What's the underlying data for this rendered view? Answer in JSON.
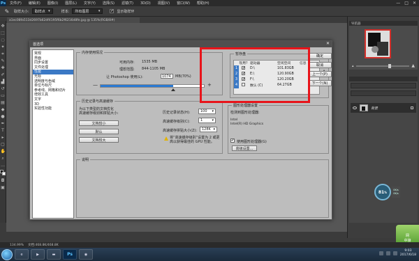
{
  "app": {
    "logo": "Ps",
    "menu": [
      "文件(F)",
      "编辑(E)",
      "图像(I)",
      "图层(L)",
      "文字(Y)",
      "选择(S)",
      "滤镜(T)",
      "3D(D)",
      "视图(V)",
      "窗口(W)",
      "帮助(H)"
    ],
    "window_controls": [
      "—",
      "□",
      "✕"
    ]
  },
  "options_bar": {
    "size_label": "取样大小:",
    "size_value": "取样点",
    "sample_label": "样本:",
    "sample_value": "所有图层",
    "ring_label": "显示取样环"
  },
  "document_tab": "a1ec08fa513d2697b62df4195f6b2f6216d8fe.jpg @ 135%(RGB/8#)",
  "dialog": {
    "title": "首选项",
    "close": "✕",
    "categories": [
      "常规",
      "界面",
      "同步设置",
      "文件处理",
      "性能",
      "光标",
      "透明度与色域",
      "单位与标尺",
      "参考线、网格和切片",
      "增效工具",
      "文字",
      "3D",
      "实验性功能"
    ],
    "selected_category": 4,
    "memory": {
      "legend": "内存使用情况",
      "available_label": "可用内存:",
      "available_value": "1535 MB",
      "ideal_label": "理想范围:",
      "ideal_value": "844-1105 MB",
      "use_label": "让 Photoshop 使用(L):",
      "use_value": "1074",
      "use_suffix": "MB(70%)",
      "percent": 70,
      "minus": "—",
      "plus": "+"
    },
    "scratch": {
      "legend": "暂存盘",
      "headers": [
        "现用?",
        "驱动器",
        "空闲空间",
        "信息"
      ],
      "rows": [
        {
          "index": "1",
          "active": "✔",
          "drive": "D:\\",
          "space": "101.83GB",
          "info": ""
        },
        {
          "index": "2",
          "active": "✔",
          "drive": "E:\\",
          "space": "120.90GB",
          "info": ""
        },
        {
          "index": "3",
          "active": "✔",
          "drive": "F:\\",
          "space": "120.20GB",
          "info": ""
        },
        {
          "index": "4",
          "active": "",
          "drive": "数认 (C)",
          "space": "64.27GB",
          "info": ""
        }
      ],
      "up_arrow": "▲",
      "down_arrow": "▼"
    },
    "buttons": {
      "ok": "确定",
      "cancel": "取消",
      "prev": "上一个(P)",
      "next": "下一个(N)"
    },
    "history": {
      "legend": "历史记录与高速缓存",
      "desc1": "为以下类型的文档优化",
      "desc2": "高速缓存级别和拼贴大小:",
      "btn_small": "文档较小",
      "btn_default": "默认",
      "btn_large": "文档较大",
      "states_label": "历史记录状态(H):",
      "states_value": "100",
      "levels_label": "高速缓存级别(C):",
      "levels_value": "1",
      "tile_label": "高速缓存拼贴大小(Z):",
      "tile_value": "128K",
      "warn_line1": "将“高速缓存级别”设置为 2 或更",
      "warn_line2": "高以获得最佳的 GPU 性能。"
    },
    "gpu": {
      "legend": "图形处理器设置",
      "detected_label": "检测到图形处理器:",
      "vendor": "Intel",
      "model": "Intel(R) HD Graphics",
      "use_label": "使用图形处理器(G)",
      "use_checked": "✔",
      "advanced_button": "高级设置..."
    },
    "description": {
      "legend": "说明"
    }
  },
  "layers": {
    "layer_name": "背景"
  },
  "navigator": {
    "header": "导航器"
  },
  "perf_widget": {
    "value": "81",
    "unit": "%",
    "up": "0K/s",
    "down": "0K/s"
  },
  "status_bar": {
    "zoom": "134.99%",
    "doc": "文档:468.8K/468.8K"
  },
  "green_badge": "网\n中接",
  "taskbar": {
    "time": "9:03",
    "date": "2017/6/18"
  }
}
